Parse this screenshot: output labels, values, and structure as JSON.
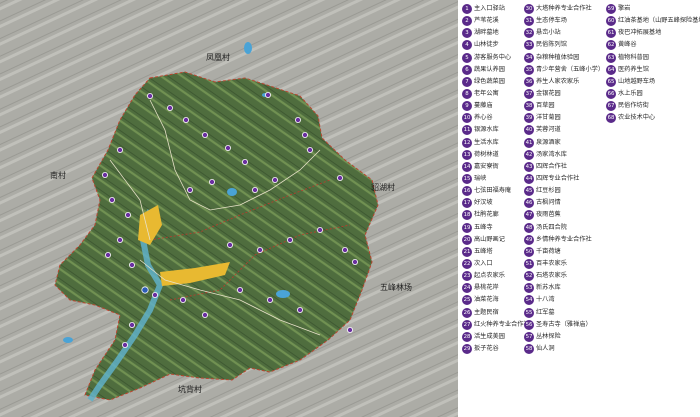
{
  "map": {
    "village_labels": {
      "fenghuang": "凤凰村",
      "nan": "南村",
      "xiaoshuicun": "貂湖村",
      "wufeng": "五峰林场",
      "kangjingcun": "坑背村"
    }
  },
  "legend": {
    "marker_color": "#5a2a8a",
    "items": [
      {
        "num": "1",
        "label": "主入口驿站"
      },
      {
        "num": "2",
        "label": "芦苇花溪"
      },
      {
        "num": "3",
        "label": "湖畔墓地"
      },
      {
        "num": "4",
        "label": "山林徒步"
      },
      {
        "num": "5",
        "label": "游客服务中心"
      },
      {
        "num": "6",
        "label": "蔬果认养园"
      },
      {
        "num": "7",
        "label": "绿色蔬菜园"
      },
      {
        "num": "8",
        "label": "老年公寓"
      },
      {
        "num": "9",
        "label": "蔓藤庙"
      },
      {
        "num": "10",
        "label": "养心谷"
      },
      {
        "num": "11",
        "label": "银源水库"
      },
      {
        "num": "12",
        "label": "生活水库"
      },
      {
        "num": "13",
        "label": "荷树林道"
      },
      {
        "num": "14",
        "label": "嘉安寮衙"
      },
      {
        "num": "15",
        "label": "瑞峡"
      },
      {
        "num": "16",
        "label": "七弦田福寿庵"
      },
      {
        "num": "17",
        "label": "好汉坡"
      },
      {
        "num": "18",
        "label": "杜鹃花廊"
      },
      {
        "num": "19",
        "label": "五峰寺"
      },
      {
        "num": "20",
        "label": "高山野画记"
      },
      {
        "num": "21",
        "label": "五峰塔"
      },
      {
        "num": "22",
        "label": "次入口"
      },
      {
        "num": "23",
        "label": "起点农家乐"
      },
      {
        "num": "24",
        "label": "悬桃花岸"
      },
      {
        "num": "25",
        "label": "油菜花海"
      },
      {
        "num": "26",
        "label": "主题民宿"
      },
      {
        "num": "27",
        "label": "红火种养专业合作社"
      },
      {
        "num": "28",
        "label": "活生成美园"
      },
      {
        "num": "29",
        "label": "扳子花谷"
      },
      {
        "num": "30",
        "label": "大塔种养专业合作社"
      },
      {
        "num": "31",
        "label": "生态停车场"
      },
      {
        "num": "32",
        "label": "悬峦小站"
      },
      {
        "num": "33",
        "label": "民俗陈列馆"
      },
      {
        "num": "34",
        "label": "杂粮种植体验园"
      },
      {
        "num": "35",
        "label": "青少年营舍（五峰小学）"
      },
      {
        "num": "36",
        "label": "养生人家农家乐"
      },
      {
        "num": "37",
        "label": "金银花园"
      },
      {
        "num": "38",
        "label": "百草园"
      },
      {
        "num": "39",
        "label": "洋甘菊园"
      },
      {
        "num": "40",
        "label": "芙蓉河道"
      },
      {
        "num": "41",
        "label": "泉源酒家"
      },
      {
        "num": "42",
        "label": "汤家湾水库"
      },
      {
        "num": "43",
        "label": "四辉合作社"
      },
      {
        "num": "44",
        "label": "四辉专业合作社"
      },
      {
        "num": "45",
        "label": "红豆杉园"
      },
      {
        "num": "46",
        "label": "古枫问情"
      },
      {
        "num": "47",
        "label": "夜雨芭蕉"
      },
      {
        "num": "48",
        "label": "汤氏四合院"
      },
      {
        "num": "49",
        "label": "乡情种养专业合作社"
      },
      {
        "num": "50",
        "label": "千亩荷塘"
      },
      {
        "num": "51",
        "label": "百丰农家乐"
      },
      {
        "num": "52",
        "label": "石塔农家乐"
      },
      {
        "num": "53",
        "label": "新苏水库"
      },
      {
        "num": "54",
        "label": "十八湾"
      },
      {
        "num": "55",
        "label": "红军墓"
      },
      {
        "num": "56",
        "label": "圣寿古寺（雅禅庙）"
      },
      {
        "num": "57",
        "label": "丛林探险"
      },
      {
        "num": "58",
        "label": "仙人洞"
      },
      {
        "num": "59",
        "label": "擎岩"
      },
      {
        "num": "60",
        "label": "红油茶基地（山野五峰探险基地）"
      },
      {
        "num": "61",
        "label": "夜巴冲拓展基地"
      },
      {
        "num": "62",
        "label": "黄峰谷"
      },
      {
        "num": "63",
        "label": "植物科普园"
      },
      {
        "num": "64",
        "label": "医药养生馆"
      },
      {
        "num": "65",
        "label": "山地越野车场"
      },
      {
        "num": "66",
        "label": "水上乐园"
      },
      {
        "num": "67",
        "label": "民俗作坊街"
      },
      {
        "num": "68",
        "label": "农业技术中心"
      }
    ]
  }
}
